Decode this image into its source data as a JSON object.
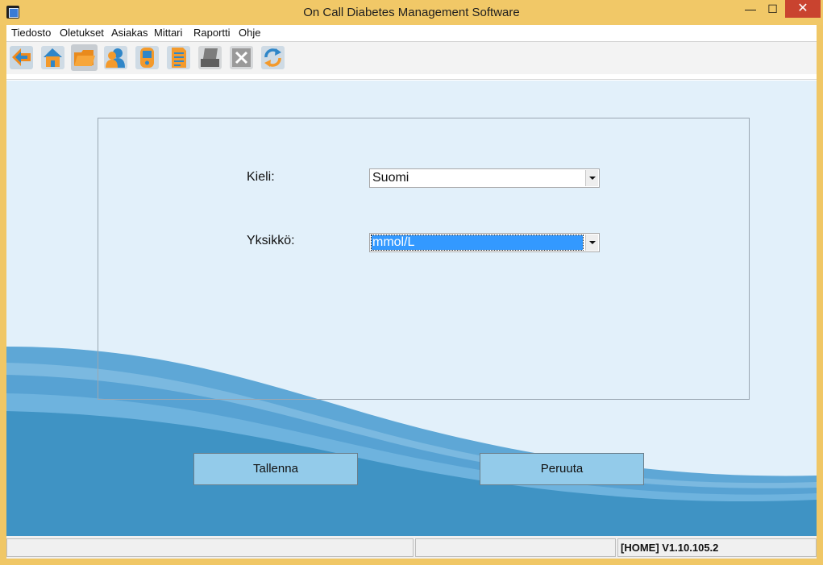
{
  "window": {
    "title": "On Call Diabetes Management Software",
    "minimize_glyph": "—",
    "maximize_glyph": "☐",
    "close_glyph": "✕"
  },
  "menu": {
    "items": [
      "Tiedosto",
      "Oletukset",
      "Asiakas",
      "Mittari",
      "Raportti",
      "Ohje"
    ]
  },
  "toolbar": {
    "icons": [
      "back-arrow-icon",
      "home-icon",
      "open-folder-icon",
      "patients-icon",
      "meter-icon",
      "report-icon",
      "print-icon",
      "excel-export-icon",
      "refresh-icon"
    ]
  },
  "form": {
    "language_label": "Kieli:",
    "language_value": "Suomi",
    "unit_label": "Yksikkö:",
    "unit_value": "mmol/L"
  },
  "buttons": {
    "save": "Tallenna",
    "cancel": "Peruuta"
  },
  "status": {
    "pane1": "",
    "pane2": "",
    "version": "[HOME] V1.10.105.2"
  },
  "colors": {
    "title_bar": "#f1c867",
    "content_bg": "#e2f0fa",
    "button_bg": "#93cbea",
    "wave_dark": "#3f93c4",
    "selection": "#3399ff"
  }
}
